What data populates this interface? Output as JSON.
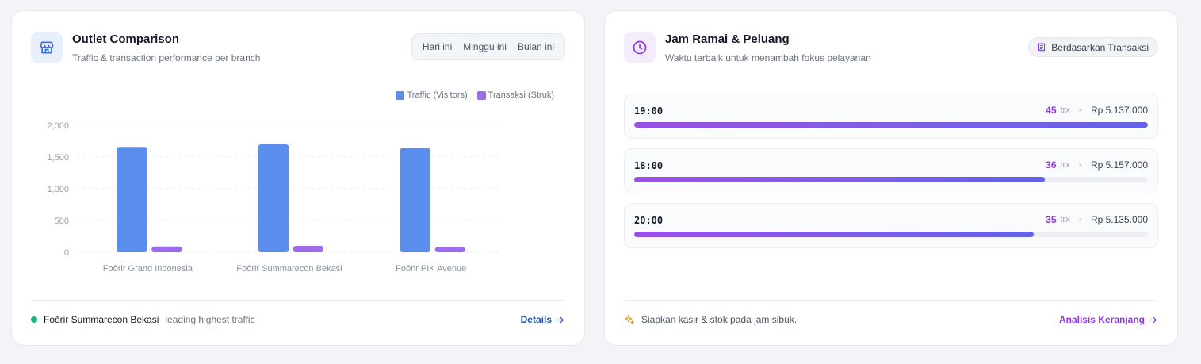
{
  "outlet_card": {
    "title": "Outlet Comparison",
    "subtitle": "Traffic & transaction performance per branch",
    "icon": "store-icon",
    "period_tabs": [
      "Hari ini",
      "Minggu ini",
      "Bulan ini"
    ],
    "footer": {
      "leader_name": "Foōrir Summarecon Bekasi",
      "leader_text": "leading highest traffic",
      "details_label": "Details",
      "status_color": "#10b981"
    }
  },
  "chart_data": {
    "type": "bar",
    "categories": [
      "Foōrir Grand Indonesia",
      "Foōrir Summarecon Bekasi",
      "Foōrir PIK Avenue"
    ],
    "series": [
      {
        "name": "Traffic (Visitors)",
        "values": [
          1660,
          1700,
          1640
        ],
        "color": "#5b8def"
      },
      {
        "name": "Transaksi (Struk)",
        "values": [
          90,
          100,
          80
        ],
        "color": "#9d6bed"
      }
    ],
    "yticks": [
      "0",
      "500",
      "1,000",
      "1,500",
      "2,000"
    ],
    "ylim": [
      0,
      2000
    ],
    "grid": true,
    "legend": "top-right"
  },
  "peak_card": {
    "title": "Jam Ramai & Peluang",
    "subtitle": "Waktu terbaik untuk menambah fokus pelayanan",
    "icon": "clock-icon",
    "badge": "Berdasarkan Transaksi",
    "badge_icon": "receipt-icon",
    "trx_unit": "trx",
    "hours": [
      {
        "time": "19:00",
        "trx": "45",
        "revenue": "Rp 5.137.000",
        "fraction": 1.0
      },
      {
        "time": "18:00",
        "trx": "36",
        "revenue": "Rp 5.157.000",
        "fraction": 0.8
      },
      {
        "time": "20:00",
        "trx": "35",
        "revenue": "Rp 5.135.000",
        "fraction": 0.778
      }
    ],
    "footer": {
      "tip": "Siapkan kasir & stok pada jam sibuk.",
      "tip_icon": "sparkle-icon",
      "link_label": "Analisis Keranjang"
    }
  }
}
